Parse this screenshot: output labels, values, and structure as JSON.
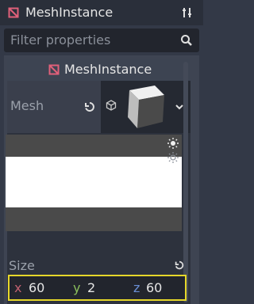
{
  "header": {
    "title": "MeshInstance"
  },
  "filter": {
    "placeholder": "Filter properties"
  },
  "section": {
    "title": "MeshInstance"
  },
  "mesh": {
    "label": "Mesh"
  },
  "size": {
    "label": "Size",
    "x_label": "x",
    "x_value": "60",
    "y_label": "y",
    "y_value": "2",
    "z_label": "z",
    "z_value": "60"
  },
  "colors": {
    "node_icon": "#e0607a",
    "highlight": "#e6d72a",
    "axis_x": "#c06070",
    "axis_y": "#8bbe5c",
    "axis_z": "#6a8fd6"
  },
  "icons": {
    "node": "mesh-instance-icon",
    "tools": "tools-icon",
    "search": "search-icon",
    "revert": "revert-icon",
    "mesh_type": "cube-outline-icon",
    "dropdown": "chevron-down-icon",
    "light1": "sun-icon",
    "light2": "sun-icon"
  }
}
